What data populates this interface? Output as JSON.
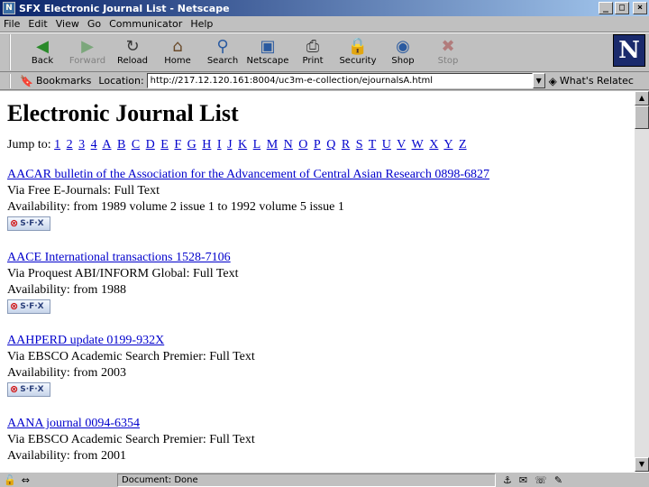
{
  "window": {
    "title": "SFX Electronic Journal List - Netscape",
    "app_icon": "netscape-icon",
    "minimize": "_",
    "maximize": "□",
    "close": "×"
  },
  "menu": [
    "File",
    "Edit",
    "View",
    "Go",
    "Communicator",
    "Help"
  ],
  "toolbar": [
    {
      "label": "Back",
      "icon": "back-arrow-icon",
      "glyph": "◀",
      "color": "#2a8a2a",
      "disabled": false
    },
    {
      "label": "Forward",
      "icon": "forward-arrow-icon",
      "glyph": "▶",
      "color": "#2a8a2a",
      "disabled": true
    },
    {
      "label": "Reload",
      "icon": "reload-icon",
      "glyph": "↻",
      "color": "#3a3a3a",
      "disabled": false
    },
    {
      "label": "Home",
      "icon": "home-icon",
      "glyph": "⌂",
      "color": "#6a4a2a",
      "disabled": false
    },
    {
      "label": "Search",
      "icon": "search-icon",
      "glyph": "⚲",
      "color": "#2a5aa0",
      "disabled": false
    },
    {
      "label": "Netscape",
      "icon": "netscape-my-icon",
      "glyph": "▣",
      "color": "#2a5aa0",
      "disabled": false
    },
    {
      "label": "Print",
      "icon": "print-icon",
      "glyph": "⎙",
      "color": "#3a3a3a",
      "disabled": false
    },
    {
      "label": "Security",
      "icon": "lock-icon",
      "glyph": "🔒",
      "color": "#a02a2a",
      "disabled": false
    },
    {
      "label": "Shop",
      "icon": "shop-icon",
      "glyph": "◉",
      "color": "#2a5aa0",
      "disabled": false
    },
    {
      "label": "Stop",
      "icon": "stop-icon",
      "glyph": "✖",
      "color": "#a02a2a",
      "disabled": true
    }
  ],
  "location": {
    "bookmarks_label": "Bookmarks",
    "location_label": "Location:",
    "url": "http://217.12.120.161:8004/uc3m-e-collection/ejournalsA.html",
    "related_label": "What's Relatec"
  },
  "page": {
    "heading": "Electronic Journal List",
    "jump_label": "Jump to:",
    "jump_items": [
      "1",
      "2",
      "3",
      "4",
      "A",
      "B",
      "C",
      "D",
      "E",
      "F",
      "G",
      "H",
      "I",
      "J",
      "K",
      "L",
      "M",
      "N",
      "O",
      "P",
      "Q",
      "R",
      "S",
      "T",
      "U",
      "V",
      "W",
      "X",
      "Y",
      "Z"
    ],
    "entries": [
      {
        "title": "AACAR bulletin of the Association for the Advancement of Central Asian Research 0898-6827",
        "via": "Via Free E-Journals: Full Text",
        "availability": "Availability: from 1989 volume 2 issue 1 to 1992 volume 5 issue 1",
        "sfx": "S·F·X"
      },
      {
        "title": "AACE International transactions 1528-7106",
        "via": "Via Proquest ABI/INFORM Global: Full Text",
        "availability": "Availability: from 1988",
        "sfx": "S·F·X"
      },
      {
        "title": "AAHPERD update 0199-932X",
        "via": "Via EBSCO Academic Search Premier: Full Text",
        "availability": "Availability: from 2003",
        "sfx": "S·F·X"
      },
      {
        "title": "AANA journal 0094-6354",
        "via": "Via EBSCO Academic Search Premier: Full Text",
        "availability": "Availability: from 2001",
        "sfx": ""
      }
    ]
  },
  "status": {
    "text": "Document: Done"
  }
}
